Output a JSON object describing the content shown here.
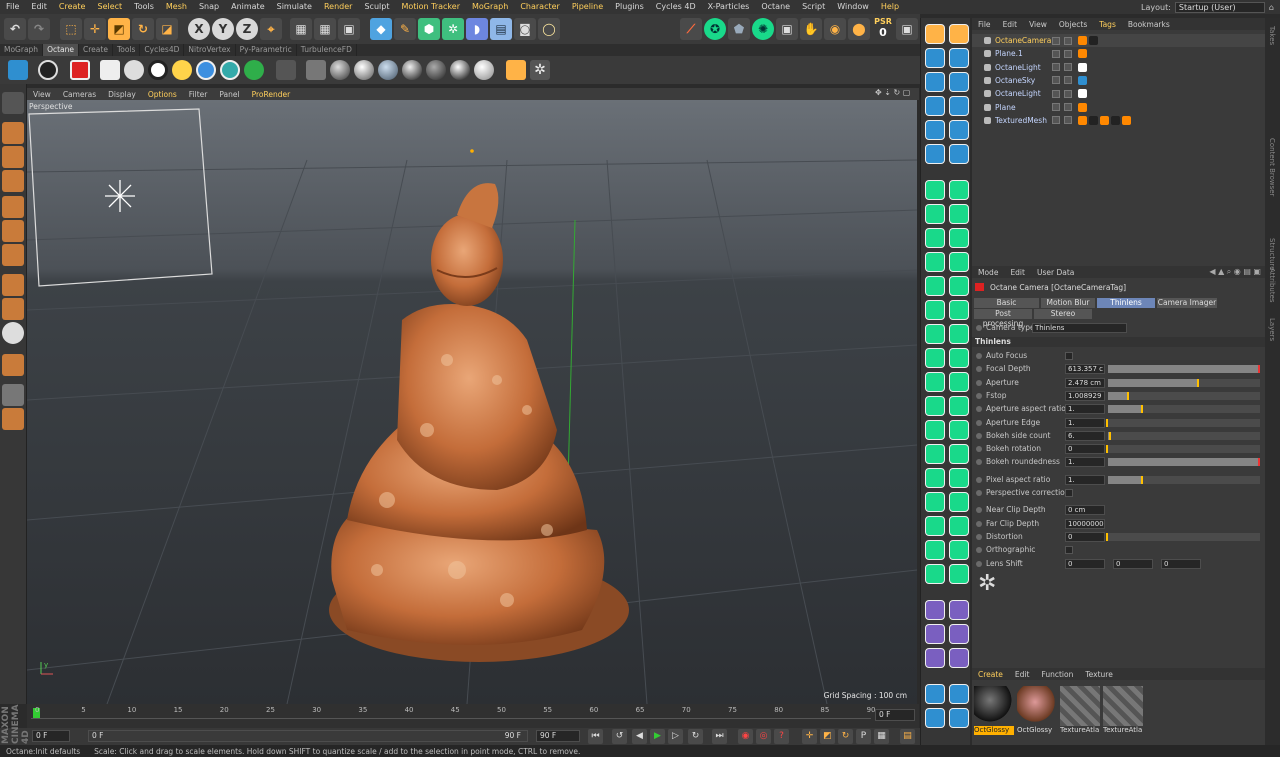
{
  "menu": {
    "items": [
      "File",
      "Edit",
      "Create",
      "Select",
      "Tools",
      "Mesh",
      "Snap",
      "Animate",
      "Simulate",
      "Render",
      "Sculpt",
      "Motion Tracker",
      "MoGraph",
      "Character",
      "Pipeline",
      "Plugins",
      "Cycles 4D",
      "X-Particles",
      "Octane",
      "Script",
      "Window",
      "Help"
    ],
    "layout_label": "Layout:",
    "layout_value": "Startup (User)"
  },
  "toolbar": {
    "psr_label": "PSR",
    "psr_value": "0"
  },
  "tabs": [
    {
      "label": "MoGraph",
      "active": false
    },
    {
      "label": "Octane",
      "active": true
    },
    {
      "label": "Create",
      "active": false
    },
    {
      "label": "Tools",
      "active": false
    },
    {
      "label": "Cycles4D",
      "active": false
    },
    {
      "label": "NitroVertex",
      "active": false
    },
    {
      "label": "Py-Parametric",
      "active": false
    },
    {
      "label": "TurbulenceFD",
      "active": false
    }
  ],
  "viewport": {
    "menu": [
      "View",
      "Cameras",
      "Display",
      "Options",
      "Filter",
      "Panel",
      "ProRender"
    ],
    "label": "Perspective",
    "grid_spacing": "Grid Spacing : 100 cm"
  },
  "timeline": {
    "ticks": [
      "0",
      "5",
      "10",
      "15",
      "20",
      "25",
      "30",
      "35",
      "40",
      "45",
      "50",
      "55",
      "60",
      "65",
      "70",
      "75",
      "80",
      "85",
      "90"
    ],
    "end_field": "0 F",
    "start_frame": "0 F",
    "current_frame": "0 F",
    "range_end": "90 F",
    "max_frame": "90 F"
  },
  "status": {
    "left": "Octane:Init defaults",
    "message": "Scale: Click and drag to scale elements. Hold down SHIFT to quantize scale / add to the selection in point mode, CTRL to remove."
  },
  "brand": "MAXON CINEMA 4D",
  "objects": {
    "header": [
      "File",
      "Edit",
      "View",
      "Objects",
      "Tags",
      "Bookmarks"
    ],
    "items": [
      {
        "name": "OctaneCamera",
        "selected": true
      },
      {
        "name": "Plane.1",
        "selected": false
      },
      {
        "name": "OctaneLight",
        "selected": false
      },
      {
        "name": "OctaneSky",
        "selected": false
      },
      {
        "name": "OctaneLight",
        "selected": false
      },
      {
        "name": "Plane",
        "selected": false
      },
      {
        "name": "TexturedMesh",
        "selected": false
      }
    ]
  },
  "sidetabs": [
    "Takes",
    "Content Browser",
    "Structure",
    "Attributes",
    "Layers"
  ],
  "attributes": {
    "header": [
      "Mode",
      "Edit",
      "User Data"
    ],
    "title": "Octane Camera [OctaneCameraTag]",
    "tabs_row1": [
      "Basic",
      "Motion Blur",
      "Thinlens",
      "Camera Imager"
    ],
    "active_tab": "Thinlens",
    "tabs_row2": [
      "Post processing",
      "Stereo"
    ],
    "camera_type_label": "Camera type",
    "camera_type_value": "Thinlens",
    "section": "Thinlens",
    "params": [
      {
        "label": "Auto Focus",
        "kind": "check"
      },
      {
        "label": "Focal Depth",
        "value": "613.357 c",
        "level": 1.0
      },
      {
        "label": "Aperture",
        "value": "2.478 cm",
        "level": 0.6
      },
      {
        "label": "Fstop",
        "value": "1.008929",
        "level": 0.14
      },
      {
        "label": "Aperture aspect ratio",
        "value": "1.",
        "level": 0.23
      },
      {
        "label": "Aperture Edge",
        "value": "1.",
        "level": 0.0
      },
      {
        "label": "Bokeh side count",
        "value": "6.",
        "level": 0.02
      },
      {
        "label": "Bokeh rotation",
        "value": "0",
        "level": 0.0
      },
      {
        "label": "Bokeh roundedness",
        "value": "1.",
        "level": 1.0
      },
      {
        "label": "Pixel aspect ratio",
        "value": "1.",
        "level": 0.23
      },
      {
        "label": "Perspective correction",
        "kind": "check"
      },
      {
        "label": "Near Clip Depth",
        "value": "0 cm",
        "kind": "field"
      },
      {
        "label": "Far Clip Depth",
        "value": "10000000",
        "kind": "field"
      },
      {
        "label": "Distortion",
        "value": "0",
        "level": 0.0
      },
      {
        "label": "Orthographic",
        "kind": "check"
      },
      {
        "label": "Lens Shift",
        "value": "0",
        "value2": "0",
        "value3": "0",
        "kind": "triple"
      }
    ]
  },
  "materials": {
    "header": [
      "Create",
      "Edit",
      "Function",
      "Texture"
    ],
    "items": [
      {
        "label": "OctGlossy",
        "kind": "sphere",
        "selected": true
      },
      {
        "label": "OctGlossy",
        "kind": "textured",
        "selected": false
      },
      {
        "label": "TextureAtla",
        "kind": "empty",
        "selected": false
      },
      {
        "label": "TextureAtla",
        "kind": "empty",
        "selected": false
      }
    ]
  },
  "colors": {
    "accent": "#ffcf5c",
    "octane_green": "#19d98a",
    "selection_blue": "#6d86b8"
  }
}
